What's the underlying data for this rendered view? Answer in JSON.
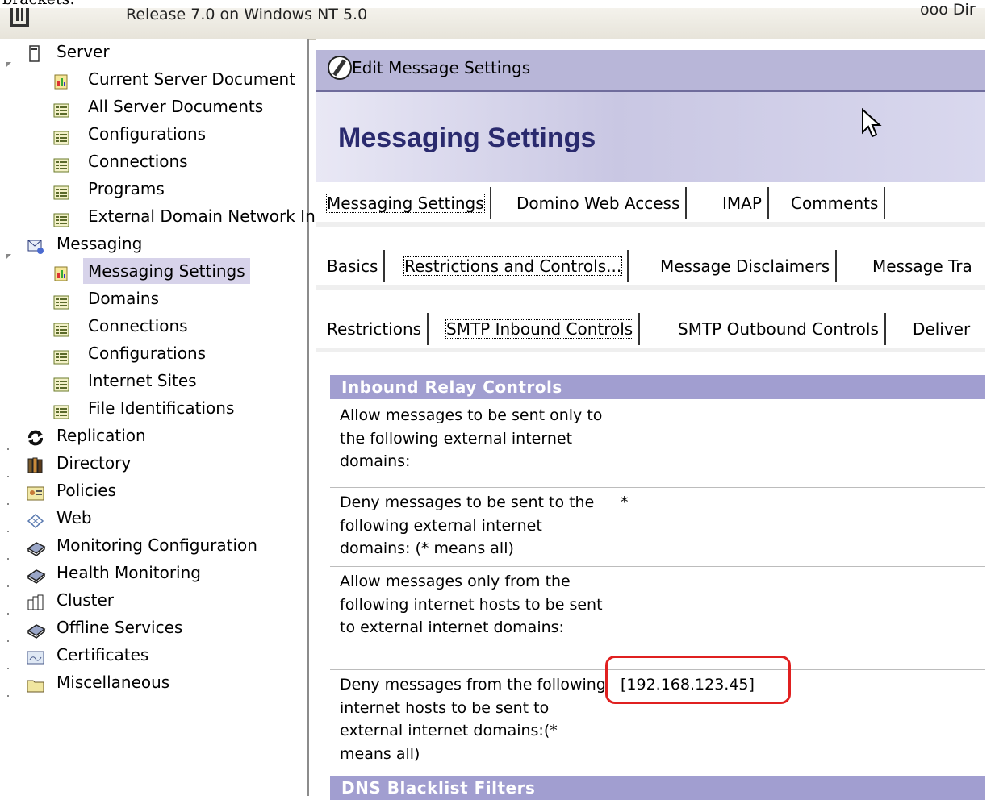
{
  "top_text": "brackets:",
  "window": {
    "release": "Release 7.0 on Windows NT 5.0",
    "cut_text": "ooo Dir"
  },
  "tree": {
    "items": [
      {
        "label": "Server",
        "icon": "server-icon"
      },
      {
        "label": "Current Server Document",
        "icon": "document-icon"
      },
      {
        "label": "All Server Documents",
        "icon": "view-icon"
      },
      {
        "label": "Configurations",
        "icon": "view-icon"
      },
      {
        "label": "Connections",
        "icon": "view-icon"
      },
      {
        "label": "Programs",
        "icon": "view-icon"
      },
      {
        "label": "External Domain Network Inf",
        "icon": "view-icon"
      },
      {
        "label": "Messaging",
        "icon": "messaging-icon"
      },
      {
        "label": "Messaging Settings",
        "icon": "document-icon"
      },
      {
        "label": "Domains",
        "icon": "view-icon"
      },
      {
        "label": "Connections",
        "icon": "view-icon"
      },
      {
        "label": "Configurations",
        "icon": "view-icon"
      },
      {
        "label": "Internet Sites",
        "icon": "view-icon"
      },
      {
        "label": "File Identifications",
        "icon": "view-icon"
      },
      {
        "label": "Replication",
        "icon": "replication-icon"
      },
      {
        "label": "Directory",
        "icon": "directory-icon"
      },
      {
        "label": "Policies",
        "icon": "policies-icon"
      },
      {
        "label": "Web",
        "icon": "web-icon"
      },
      {
        "label": "Monitoring Configuration",
        "icon": "book-icon"
      },
      {
        "label": "Health Monitoring",
        "icon": "book-icon"
      },
      {
        "label": "Cluster",
        "icon": "cluster-icon"
      },
      {
        "label": "Offline Services",
        "icon": "book-icon"
      },
      {
        "label": "Certificates",
        "icon": "certificate-icon"
      },
      {
        "label": "Miscellaneous",
        "icon": "folder-icon"
      }
    ]
  },
  "actionbar": {
    "edit_label": "Edit Message Settings"
  },
  "hero": {
    "title": "Messaging Settings"
  },
  "tabs1": [
    "Messaging Settings",
    "Domino Web Access",
    "IMAP",
    "Comments"
  ],
  "tabs2": [
    "Basics",
    "Restrictions and Controls...",
    "Message Disclaimers",
    "Message Tra"
  ],
  "tabs3": [
    "Restrictions",
    "SMTP Inbound Controls",
    "SMTP Outbound Controls",
    "Deliver"
  ],
  "section1": "Inbound Relay Controls",
  "rows": [
    {
      "label": "Allow messages to be sent only to the following external internet domains:",
      "value": ""
    },
    {
      "label": "Deny messages to be sent to the following external internet domains: (* means all)",
      "value": "*"
    },
    {
      "label": "Allow messages only from the following internet hosts to be sent to external internet domains:",
      "value": ""
    },
    {
      "label": "Deny messages from the following internet hosts to be sent to external internet domains:(* means all)",
      "value": "[192.168.123.45]"
    }
  ],
  "section2": "DNS Blacklist Filters",
  "colors": {
    "section_bg": "#a19ed0",
    "highlight": "#e02020",
    "selected_bg": "#d7d3ea",
    "title": "#2a2a6e"
  }
}
